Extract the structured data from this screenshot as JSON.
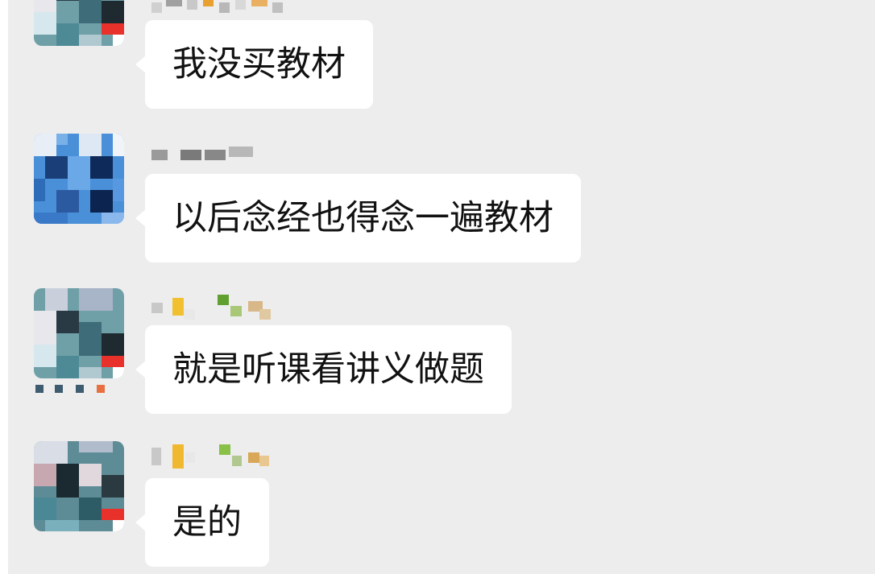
{
  "messages": [
    {
      "text": "我没买教材"
    },
    {
      "text": "以后念经也得念一遍教材"
    },
    {
      "text": "就是听课看讲义做题"
    },
    {
      "text": "是的"
    }
  ],
  "colors": {
    "chat_background": "#ededed",
    "bubble": "#ffffff",
    "text": "#111111"
  }
}
